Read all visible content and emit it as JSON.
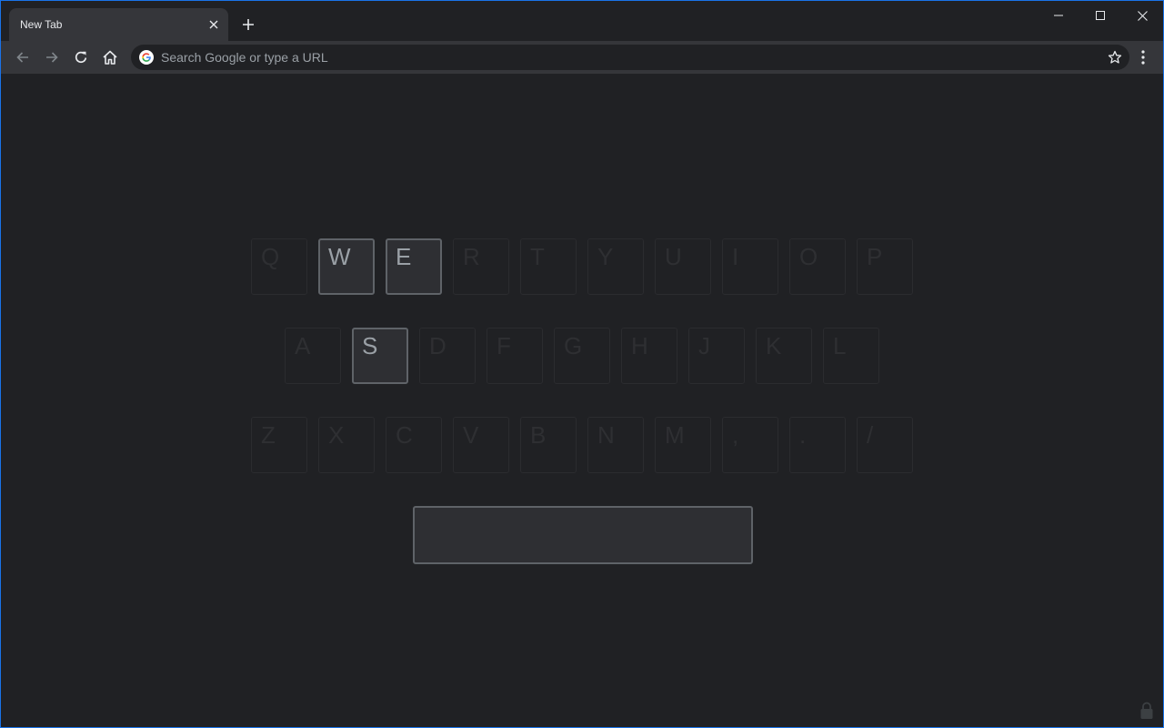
{
  "browser": {
    "tab": {
      "title": "New Tab"
    },
    "omnibox": {
      "placeholder": "Search Google or type a URL",
      "value": ""
    }
  },
  "keyboard": {
    "row1": [
      "Q",
      "W",
      "E",
      "R",
      "T",
      "Y",
      "U",
      "I",
      "O",
      "P"
    ],
    "row2": [
      "A",
      "S",
      "D",
      "F",
      "G",
      "H",
      "J",
      "K",
      "L"
    ],
    "row3": [
      "Z",
      "X",
      "C",
      "V",
      "B",
      "N",
      "M",
      ",",
      ".",
      "/"
    ],
    "active_keys": [
      "W",
      "E",
      "S",
      "space"
    ]
  },
  "colors": {
    "accent": "#1a73e8",
    "background": "#202124",
    "toolbar": "#35363a",
    "active_key_border": "#5f6368"
  }
}
